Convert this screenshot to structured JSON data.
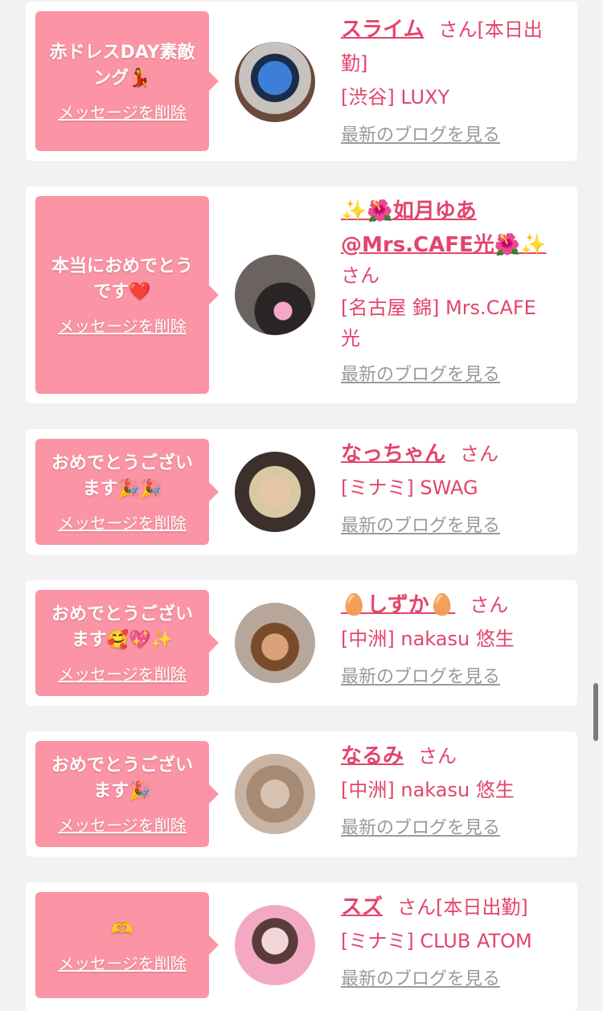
{
  "delete_label": "メッセージを削除",
  "blog_label": "最新のブログを見る",
  "san_label": "さん",
  "cards": [
    {
      "message": "赤ドレスDAY素敵\nング💃",
      "name": "スライム",
      "suffix": "[本日出\n勤]",
      "shop": "[渋谷] LUXY"
    },
    {
      "message": "本当におめでとう\nです❤️",
      "name": "✨🌺如月ゆあ\n@Mrs.CAFE光🌺✨",
      "suffix": "",
      "shop": "[名古屋 錦] Mrs.CAFE\n光"
    },
    {
      "message": "おめでとうござい\nます🎉🎉",
      "name": "なっちゃん",
      "suffix": "",
      "shop": "[ミナミ] SWAG"
    },
    {
      "message": "おめでとうござい\nます🥰💖✨",
      "name": "🥚しずか🥚",
      "suffix": "",
      "shop": "[中洲] nakasu 悠生"
    },
    {
      "message": "おめでとうござい\nます🎉",
      "name": "なるみ",
      "suffix": "",
      "shop": "[中洲] nakasu 悠生"
    },
    {
      "message": "🫶",
      "name": "スズ",
      "suffix": "[本日出勤]",
      "shop": "[ミナミ] CLUB ATOM"
    }
  ],
  "colors": {
    "accent": "#e2456b",
    "bubble": "#fb94a4",
    "background": "#f2f2f2",
    "card": "#ffffff",
    "link_gray": "#9a9a9a"
  }
}
